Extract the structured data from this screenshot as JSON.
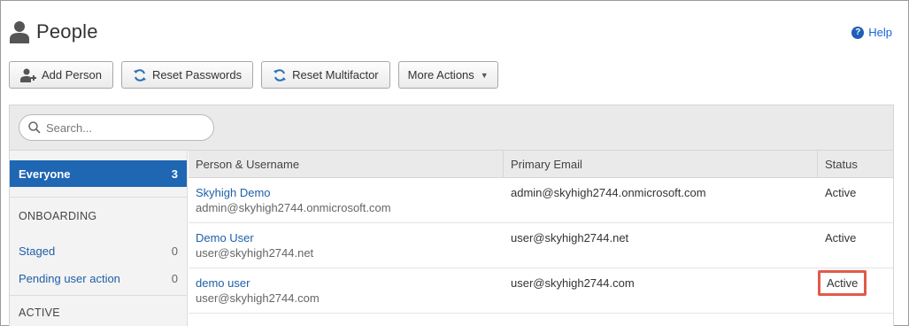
{
  "header": {
    "title": "People",
    "help_label": "Help"
  },
  "toolbar": {
    "add_person": "Add Person",
    "reset_passwords": "Reset Passwords",
    "reset_multifactor": "Reset Multifactor",
    "more_actions": "More Actions"
  },
  "search": {
    "placeholder": "Search..."
  },
  "sidebar": {
    "everyone_label": "Everyone",
    "everyone_count": "3",
    "onboarding_heading": "ONBOARDING",
    "staged_label": "Staged",
    "staged_count": "0",
    "pending_label": "Pending user action",
    "pending_count": "0",
    "active_heading": "ACTIVE"
  },
  "table": {
    "columns": [
      "Person & Username",
      "Primary Email",
      "Status"
    ],
    "rows": [
      {
        "name": "Skyhigh Demo",
        "username": "admin@skyhigh2744.onmicrosoft.com",
        "email": "admin@skyhigh2744.onmicrosoft.com",
        "status": "Active"
      },
      {
        "name": "Demo User",
        "username": "user@skyhigh2744.net",
        "email": "user@skyhigh2744.net",
        "status": "Active"
      },
      {
        "name": "demo user",
        "username": "user@skyhigh2744.com",
        "email": "user@skyhigh2744.com",
        "status": "Active"
      }
    ]
  },
  "colors": {
    "accent": "#1f66b3",
    "highlight_border": "#e05a4b",
    "link": "#1f5fa8"
  }
}
